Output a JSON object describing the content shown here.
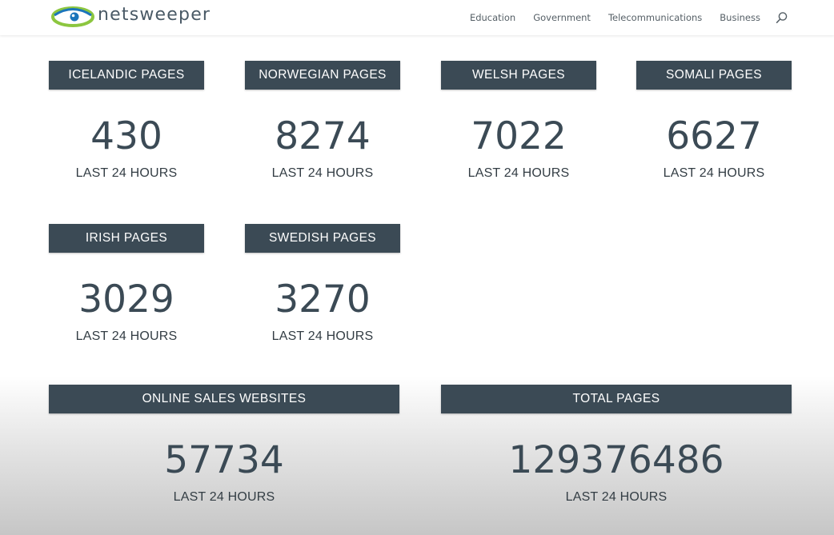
{
  "brand": {
    "name": "netsweeper"
  },
  "nav": {
    "items": [
      "Education",
      "Government",
      "Telecommunications",
      "Business"
    ]
  },
  "stats": {
    "icelandic": {
      "title": "ICELANDIC PAGES",
      "value": "430",
      "period": "LAST 24 HOURS"
    },
    "norwegian": {
      "title": "NORWEGIAN PAGES",
      "value": "8274",
      "period": "LAST 24 HOURS"
    },
    "welsh": {
      "title": "WELSH PAGES",
      "value": "7022",
      "period": "LAST 24 HOURS"
    },
    "somali": {
      "title": "SOMALI PAGES",
      "value": "6627",
      "period": "LAST 24 HOURS"
    },
    "irish": {
      "title": "IRISH PAGES",
      "value": "3029",
      "period": "LAST 24 HOURS"
    },
    "swedish": {
      "title": "SWEDISH PAGES",
      "value": "3270",
      "period": "LAST 24 HOURS"
    },
    "online_sales": {
      "title": "ONLINE SALES WEBSITES",
      "value": "57734",
      "period": "LAST 24 HOURS"
    },
    "total": {
      "title": "TOTAL PAGES",
      "value": "129376486",
      "period": "LAST 24 HOURS"
    }
  },
  "colors": {
    "header_bar": "#3b4a55",
    "value_text": "#3b4a55",
    "logo_green": "#8cc63f",
    "logo_blue": "#1b75bb"
  },
  "icons": {
    "search": "search-icon",
    "logo": "netsweeper-logo-icon"
  }
}
